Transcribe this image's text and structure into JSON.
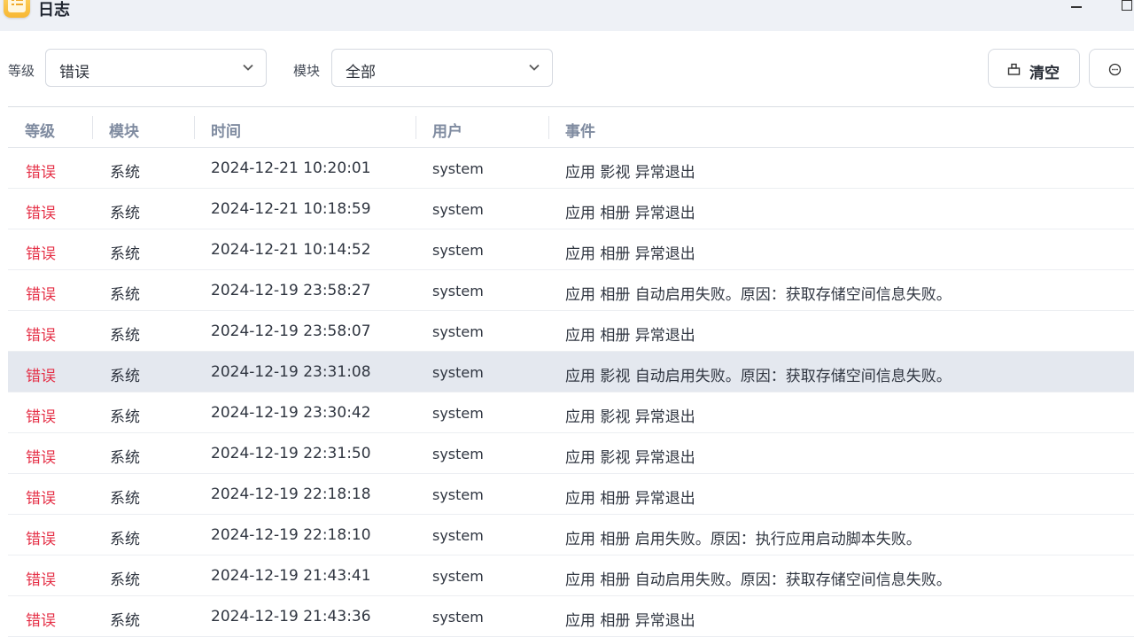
{
  "window": {
    "title": "日志"
  },
  "filters": {
    "level_label": "等级",
    "level_value": "错误",
    "module_label": "模块",
    "module_value": "全部"
  },
  "toolbar": {
    "clear_label": "清空"
  },
  "table": {
    "headers": [
      "等级",
      "模块",
      "时间",
      "用户",
      "事件"
    ],
    "rows": [
      {
        "level": "错误",
        "module": "系统",
        "time": "2024-12-21 10:20:01",
        "user": "system",
        "event": "应用 影视 异常退出"
      },
      {
        "level": "错误",
        "module": "系统",
        "time": "2024-12-21 10:18:59",
        "user": "system",
        "event": "应用 相册 异常退出"
      },
      {
        "level": "错误",
        "module": "系统",
        "time": "2024-12-21 10:14:52",
        "user": "system",
        "event": "应用 相册 异常退出"
      },
      {
        "level": "错误",
        "module": "系统",
        "time": "2024-12-19 23:58:27",
        "user": "system",
        "event": "应用 相册 自动启用失败。原因：获取存储空间信息失败。"
      },
      {
        "level": "错误",
        "module": "系统",
        "time": "2024-12-19 23:58:07",
        "user": "system",
        "event": "应用 相册 异常退出"
      },
      {
        "level": "错误",
        "module": "系统",
        "time": "2024-12-19 23:31:08",
        "user": "system",
        "event": "应用 影视 自动启用失败。原因：获取存储空间信息失败。"
      },
      {
        "level": "错误",
        "module": "系统",
        "time": "2024-12-19 23:30:42",
        "user": "system",
        "event": "应用 影视 异常退出"
      },
      {
        "level": "错误",
        "module": "系统",
        "time": "2024-12-19 22:31:50",
        "user": "system",
        "event": "应用 影视 异常退出"
      },
      {
        "level": "错误",
        "module": "系统",
        "time": "2024-12-19 22:18:18",
        "user": "system",
        "event": "应用 相册 异常退出"
      },
      {
        "level": "错误",
        "module": "系统",
        "time": "2024-12-19 22:18:10",
        "user": "system",
        "event": "应用 相册 启用失败。原因：执行应用启动脚本失败。"
      },
      {
        "level": "错误",
        "module": "系统",
        "time": "2024-12-19 21:43:41",
        "user": "system",
        "event": "应用 相册 自动启用失败。原因：获取存储空间信息失败。"
      },
      {
        "level": "错误",
        "module": "系统",
        "time": "2024-12-19 21:43:36",
        "user": "system",
        "event": "应用 相册 异常退出"
      }
    ]
  },
  "colors": {
    "error": "#e53047",
    "header": "#7f8ba0",
    "highlight": "#e4e8ef"
  },
  "icons": [
    "app-log-icon",
    "minimize-icon",
    "maximize-icon",
    "chevron-down-icon",
    "clear-icon",
    "more-icon"
  ]
}
